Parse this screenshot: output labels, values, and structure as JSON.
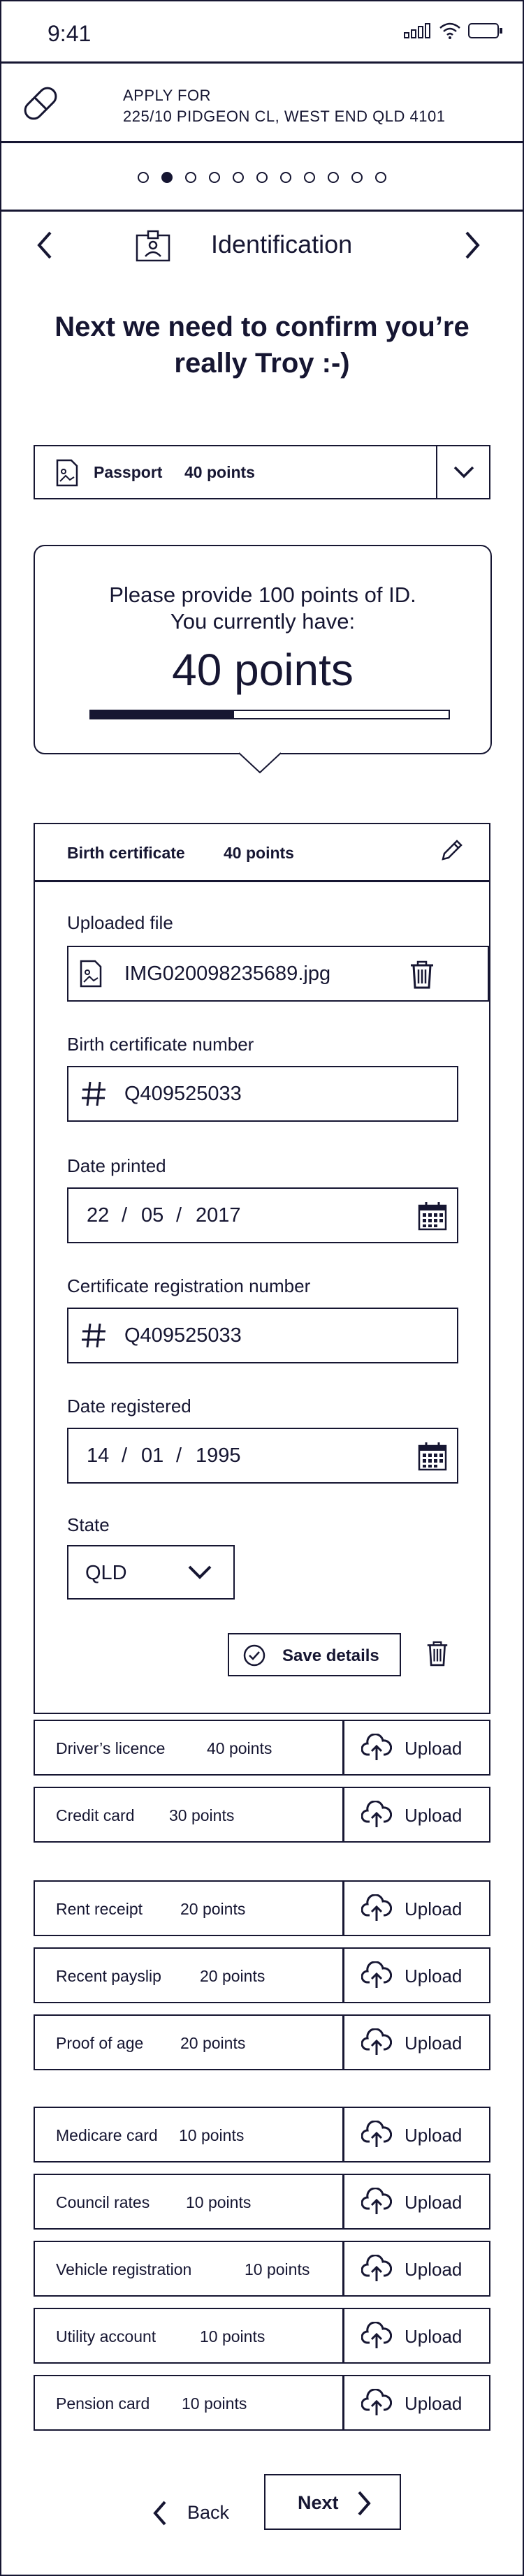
{
  "status_bar": {
    "time": "9:41"
  },
  "application": {
    "apply_for_label": "APPLY FOR",
    "address": "225/10 PIDGEON CL, WEST END QLD 4101"
  },
  "progress_steps": {
    "total": 11,
    "current": 2
  },
  "step": {
    "title": "Identification"
  },
  "heading": {
    "line1": "Next we need to confirm you’re",
    "line2": "really Troy :-)"
  },
  "selected_document": {
    "name": "Passport",
    "points": "40 points"
  },
  "points_summary": {
    "line1": "Please provide 100 points of ID.",
    "line2": "You currently have:",
    "current": "40 points",
    "progress_fraction": 0.4
  },
  "birth_certificate": {
    "name": "Birth certificate",
    "points": "40 points",
    "uploaded_file_label": "Uploaded file",
    "uploaded_file_name": "IMG020098235689.jpg",
    "certificate_number_label": "Birth certificate number",
    "certificate_number": "Q409525033",
    "date_printed_label": "Date printed",
    "date_printed": {
      "day": "22",
      "month": "05",
      "year": "2017"
    },
    "registration_number_label": "Certificate registration number",
    "registration_number": "Q409525033",
    "date_registered_label": "Date registered",
    "date_registered": {
      "day": "14",
      "month": "01",
      "year": "1995"
    },
    "state_label": "State",
    "state": "QLD",
    "save_label": "Save details"
  },
  "date_separator": "/",
  "upload_label": "Upload",
  "documents": [
    {
      "name": "Driver’s licence",
      "points": "40 points"
    },
    {
      "name": "Credit card",
      "points": "30 points"
    },
    {
      "name": "Rent receipt",
      "points": "20 points"
    },
    {
      "name": "Recent payslip",
      "points": "20 points"
    },
    {
      "name": "Proof of age",
      "points": "20 points"
    },
    {
      "name": "Medicare card",
      "points": "10 points"
    },
    {
      "name": "Council rates",
      "points": "10 points"
    },
    {
      "name": "Vehicle registration",
      "points": "10 points"
    },
    {
      "name": "Utility account",
      "points": "10 points"
    },
    {
      "name": "Pension card",
      "points": "10 points"
    }
  ],
  "footer": {
    "back_label": "Back",
    "next_label": "Next"
  },
  "colors": {
    "ink": "#161632",
    "background": "#ffffff"
  }
}
